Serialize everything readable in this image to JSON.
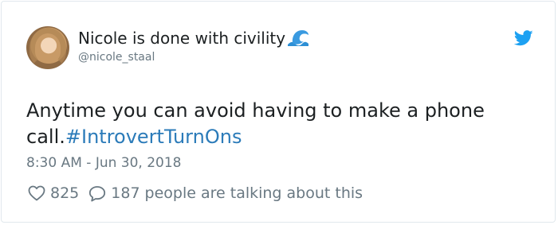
{
  "tweet": {
    "author_name": "Nicole is done with civility",
    "author_handle": "@nicole_staal",
    "text": "Anytime you can avoid having to make a phone call.",
    "hashtag": "#IntrovertTurnOns",
    "timestamp": "8:30 AM - Jun 30, 2018",
    "like_count": "825",
    "reply_count": "187",
    "talking_label": "people are talking about this"
  },
  "icons": {
    "name_emoji": "water-wave-icon",
    "logo": "twitter-bird-icon",
    "like": "heart-icon",
    "reply": "speech-bubble-icon"
  },
  "colors": {
    "link": "#2b7bb9",
    "muted": "#697882",
    "text": "#1c2022",
    "twitter_blue": "#1da1f2"
  }
}
